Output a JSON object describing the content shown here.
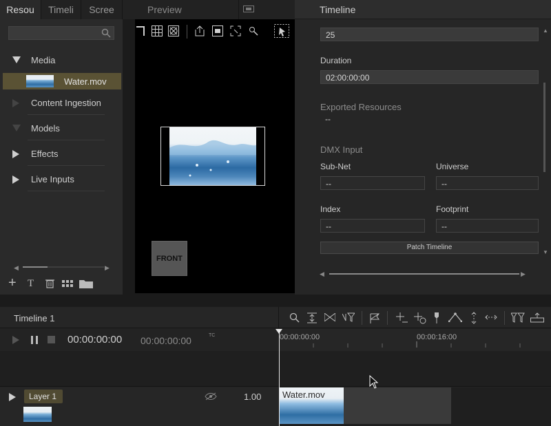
{
  "left_panel": {
    "tabs": [
      "Resou",
      "Timeli",
      "Scree"
    ],
    "tree": [
      {
        "label": "Media",
        "expanded": true
      },
      {
        "label": "Water.mov",
        "selected": true
      },
      {
        "label": "Content Ingestion"
      },
      {
        "label": "Models"
      },
      {
        "label": "Effects"
      },
      {
        "label": "Live Inputs"
      }
    ]
  },
  "preview": {
    "title": "Preview",
    "front_label": "FRONT"
  },
  "inspector": {
    "title": "Timeline",
    "rate_value": "25",
    "duration_label": "Duration",
    "duration_value": "02:00:00:00",
    "exported_label": "Exported Resources",
    "exported_value": "--",
    "dmx_label": "DMX Input",
    "subnet_label": "Sub-Net",
    "subnet_value": "--",
    "universe_label": "Universe",
    "universe_value": "--",
    "index_label": "Index",
    "index_value": "--",
    "footprint_label": "Footprint",
    "footprint_value": "--",
    "patch_button": "Patch Timeline"
  },
  "timeline": {
    "title": "Timeline 1",
    "timecode": "00:00:00:00",
    "timecode_secondary": "00:00:00:00",
    "tc_label": "TC",
    "ruler_labels": [
      "00:00:00:00",
      "00:00:16:00"
    ],
    "layer_name": "Layer 1",
    "layer_opacity": "1.00",
    "clip_name": "Water.mov"
  },
  "colors": {
    "selection": "#5a5234",
    "layer_badge": "#504a32",
    "water_blue": "#3f7fb5"
  }
}
